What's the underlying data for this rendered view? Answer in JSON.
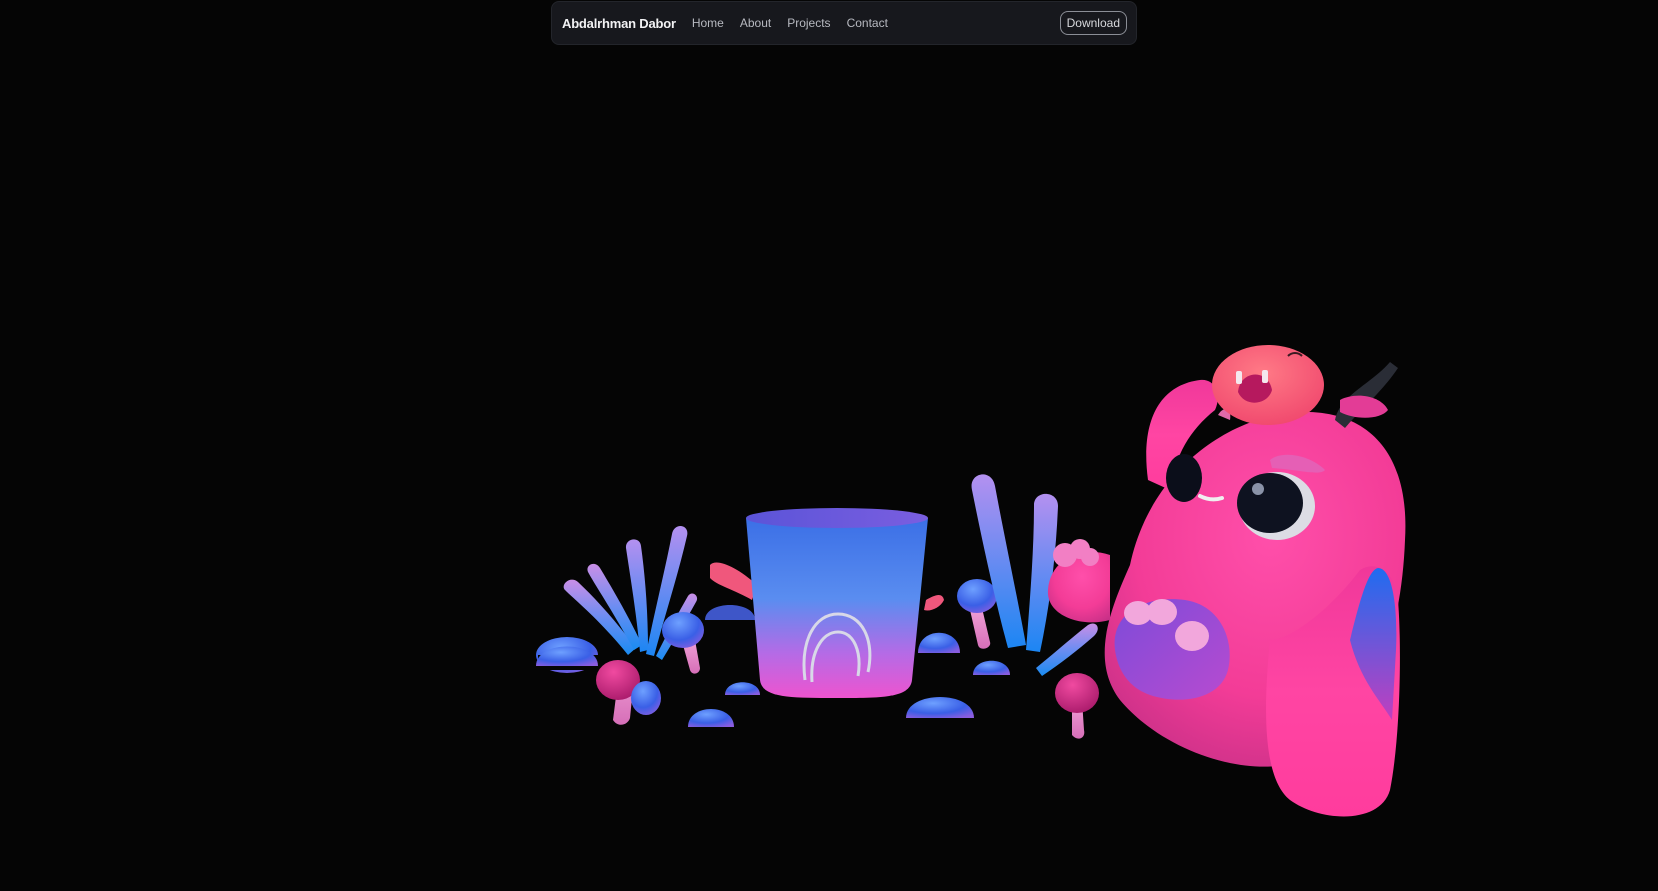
{
  "navbar": {
    "brand": "Abdalrhman Dabor",
    "links": [
      {
        "label": "Home"
      },
      {
        "label": "About"
      },
      {
        "label": "Projects"
      },
      {
        "label": "Contact"
      }
    ],
    "download_label": "Download"
  },
  "scene": {
    "background_color": "#050505",
    "creature_color": "#ff3fa0",
    "pot_top_color": "#3a6ee8",
    "pot_bottom_color": "#e24fd0",
    "mushroom_color": "#4a7dff"
  }
}
